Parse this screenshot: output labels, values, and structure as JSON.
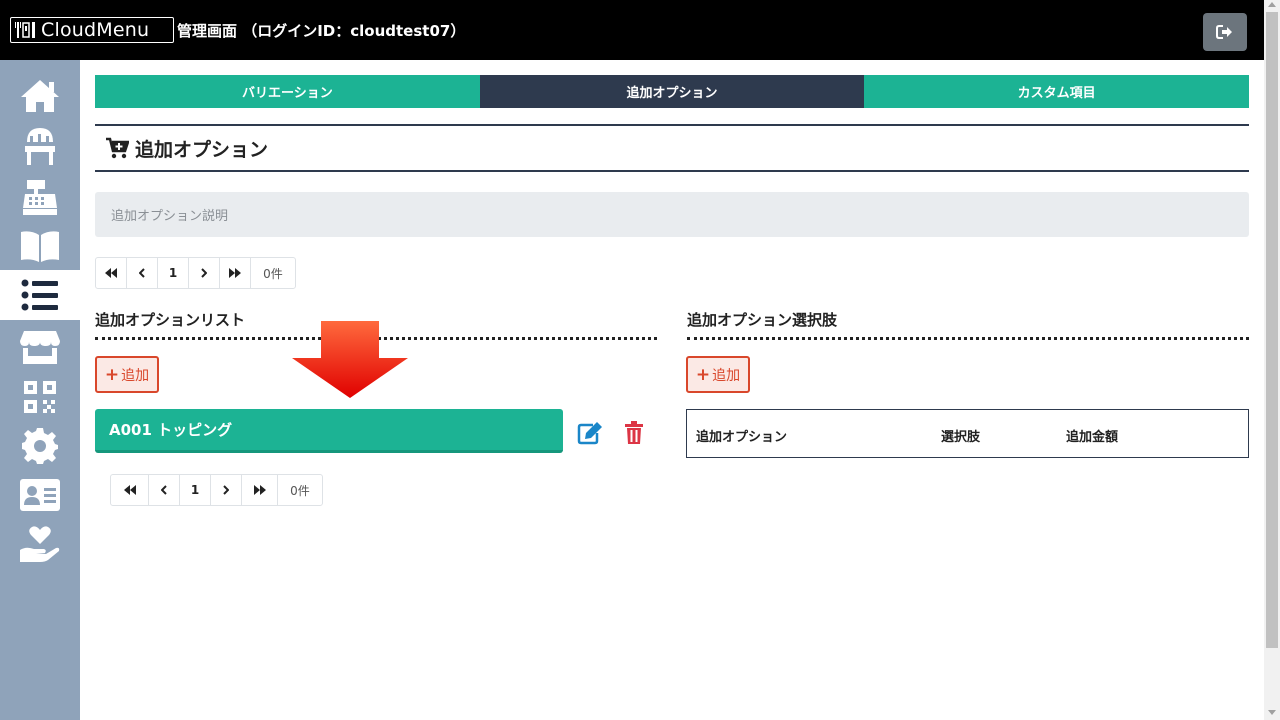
{
  "header": {
    "logo_text": "CloudMenu",
    "title": "管理画面 （ログインID：cloudtest07）",
    "logout_icon": "sign-out-icon"
  },
  "sidebar": {
    "items": [
      {
        "icon": "home-icon"
      },
      {
        "icon": "chair-icon"
      },
      {
        "icon": "cash-register-icon"
      },
      {
        "icon": "book-icon"
      },
      {
        "icon": "list-icon",
        "active": true
      },
      {
        "icon": "store-icon"
      },
      {
        "icon": "qrcode-icon"
      },
      {
        "icon": "gear-icon"
      },
      {
        "icon": "id-card-icon"
      },
      {
        "icon": "hand-heart-icon"
      }
    ]
  },
  "tabs": [
    {
      "label": "バリエーション",
      "active": false
    },
    {
      "label": "追加オプション",
      "active": true
    },
    {
      "label": "カスタム項目",
      "active": false
    }
  ],
  "page": {
    "title": "追加オプション",
    "description_placeholder": "追加オプション説明"
  },
  "pager_top": {
    "first": "«",
    "prev": "‹",
    "page": "1",
    "next": "›",
    "last": "»",
    "count": "0件"
  },
  "pager_bottom": {
    "first": "«",
    "prev": "‹",
    "page": "1",
    "next": "›",
    "last": "»",
    "count": "0件"
  },
  "left_panel": {
    "title": "追加オプションリスト",
    "add_label": "追加",
    "items": [
      {
        "label": "A001 トッピング"
      }
    ]
  },
  "right_panel": {
    "title": "追加オプション選択肢",
    "add_label": "追加",
    "table_headers": [
      "追加オプション",
      "選択肢",
      "追加金額"
    ]
  },
  "colors": {
    "accent_green": "#1cb394",
    "dark_navy": "#2e3a4e",
    "sidebar_bg": "#8fa3ba",
    "danger_red": "#d9472b",
    "edit_blue": "#1a86c8"
  }
}
